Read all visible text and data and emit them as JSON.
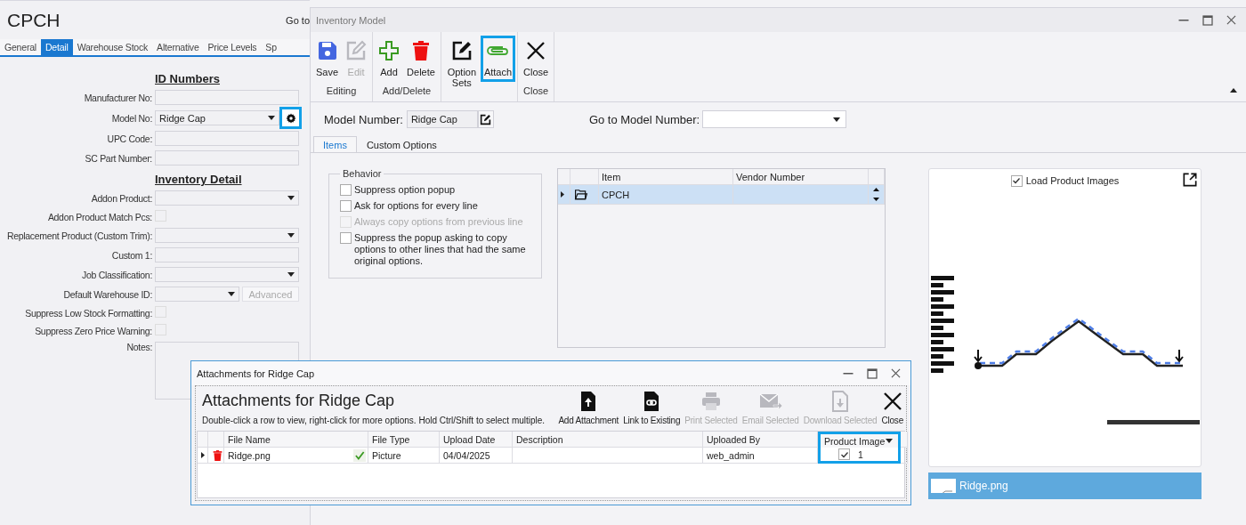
{
  "background_form": {
    "title": "CPCH",
    "goto_label": "Go to",
    "tabs": [
      {
        "label": "General",
        "selected": false
      },
      {
        "label": "Detail",
        "selected": true
      },
      {
        "label": "Warehouse Stock",
        "selected": false
      },
      {
        "label": "Alternative",
        "selected": false
      },
      {
        "label": "Price Levels",
        "selected": false
      },
      {
        "label": "Sp",
        "selected": false
      }
    ],
    "sections": [
      {
        "heading": "ID Numbers",
        "fields": [
          {
            "label": "Manufacturer No:",
            "kind": "text"
          },
          {
            "label": "Model No:",
            "kind": "dropdown_gear",
            "value": "Ridge Cap",
            "highlighted": true
          },
          {
            "label": "UPC Code:",
            "kind": "text"
          },
          {
            "label": "SC Part Number:",
            "kind": "text"
          }
        ]
      },
      {
        "heading": "Inventory Detail",
        "fields": [
          {
            "label": "Addon Product:",
            "kind": "dropdown"
          },
          {
            "label": "Addon Product Match Pcs:",
            "kind": "checkbox",
            "checked": false
          },
          {
            "label": "Replacement Product (Custom Trim):",
            "kind": "dropdown"
          },
          {
            "label": "Custom 1:",
            "kind": "text"
          },
          {
            "label": "Job Classification:",
            "kind": "dropdown"
          },
          {
            "label": "Default Warehouse ID:",
            "kind": "dropdown_button",
            "button_label": "Advanced",
            "button_disabled": true
          },
          {
            "label": "Suppress Low Stock Formatting:",
            "kind": "checkbox",
            "checked": false
          },
          {
            "label": "Suppress Zero Price Warning:",
            "kind": "checkbox",
            "checked": false
          },
          {
            "label": "Notes:",
            "kind": "textarea"
          }
        ]
      }
    ]
  },
  "inventory_window": {
    "title": "Inventory Model",
    "ribbon": {
      "groups": [
        {
          "label": "Editing",
          "buttons": [
            {
              "label": "Save",
              "kind": "save",
              "disabled": false,
              "highlighted": false
            },
            {
              "label": "Edit",
              "kind": "edit",
              "disabled": true,
              "highlighted": false
            }
          ]
        },
        {
          "label": "Add/Delete",
          "buttons": [
            {
              "label": "Add",
              "kind": "add",
              "disabled": false,
              "highlighted": false
            },
            {
              "label": "Delete",
              "kind": "delete",
              "disabled": false,
              "highlighted": false
            }
          ]
        },
        {
          "buttons": [
            {
              "label": "Option Sets",
              "kind": "edit_box",
              "disabled": false,
              "highlighted": false
            },
            {
              "label": "Attach",
              "kind": "clip",
              "disabled": false,
              "highlighted": true
            }
          ]
        },
        {
          "label": "Close",
          "buttons": [
            {
              "label": "Close",
              "kind": "close",
              "disabled": false,
              "highlighted": false
            }
          ]
        }
      ]
    },
    "model_number": {
      "label": "Model Number:",
      "value": "Ridge Cap"
    },
    "goto_model": {
      "label": "Go to Model Number:"
    },
    "tabs": [
      {
        "label": "Items",
        "selected": true
      },
      {
        "label": "Custom Options",
        "selected": false
      }
    ],
    "behavior": {
      "title": "Behavior",
      "options": [
        {
          "label": "Suppress option popup",
          "checked": false,
          "disabled": false
        },
        {
          "label": "Ask for options for every line",
          "checked": false,
          "disabled": false
        },
        {
          "label": "Always copy options from previous line",
          "checked": false,
          "disabled": true
        },
        {
          "label": "Suppress the popup asking to copy options to other lines that had the same original options.",
          "checked": false,
          "disabled": false
        }
      ]
    },
    "items_grid": {
      "columns": [
        "Item",
        "Vendor Number"
      ],
      "rows": [
        {
          "item": "CPCH",
          "selected": true
        }
      ]
    },
    "image_panel": {
      "load_label": "Load Product Images",
      "load_checked": true,
      "files": [
        {
          "name": "Ridge.png",
          "selected": true
        }
      ]
    }
  },
  "attachments_dialog": {
    "title": "Attachments for Ridge Cap",
    "heading": "Attachments for Ridge Cap",
    "hint": "Double-click a row to view, right-click for more options. Hold Ctrl/Shift to select multiple.",
    "actions": [
      {
        "label": "Add Attachment",
        "kind": "upload",
        "disabled": false
      },
      {
        "label": "Link to Existing",
        "kind": "link",
        "disabled": false
      },
      {
        "label": "Print Selected",
        "kind": "print",
        "disabled": true
      },
      {
        "label": "Email Selected",
        "kind": "email",
        "disabled": true
      },
      {
        "label": "Download Selected",
        "kind": "download",
        "disabled": true
      },
      {
        "label": "Close",
        "kind": "close",
        "disabled": false
      }
    ],
    "columns": [
      {
        "label": "File Name",
        "highlighted": false
      },
      {
        "label": "File Type",
        "highlighted": false
      },
      {
        "label": "Upload Date",
        "highlighted": false
      },
      {
        "label": "Description",
        "highlighted": false
      },
      {
        "label": "Uploaded By",
        "highlighted": false
      },
      {
        "label": "Product Image",
        "highlighted": true
      }
    ],
    "rows": [
      {
        "file_name": "Ridge.png",
        "file_type": "Picture",
        "upload_date": "04/04/2025",
        "uploaded_by": "web_admin",
        "product_image": true,
        "image_order": "1"
      }
    ]
  }
}
